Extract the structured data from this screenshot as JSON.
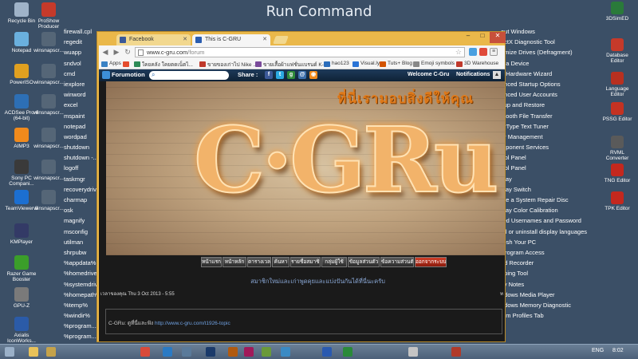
{
  "desktop": {
    "title": "Run Command",
    "left_icons": [
      {
        "label": "Recycle Bin",
        "color": "#9fb3c8"
      },
      {
        "label": "ProShow Producer",
        "color": "#c53a2a"
      },
      {
        "label": "Notepad",
        "color": "#6ab0de"
      },
      {
        "label": "winsnapscr...",
        "color": "#556677"
      },
      {
        "label": "PowerISO",
        "color": "#e0a020"
      },
      {
        "label": "winsnapscr...",
        "color": "#556677"
      },
      {
        "label": "ACDSee Pro 6 (64-bit)",
        "color": "#2d6fb5"
      },
      {
        "label": "winsnapscr...",
        "color": "#556677"
      },
      {
        "label": "AIMP3",
        "color": "#f08a1c"
      },
      {
        "label": "winsnapscr...",
        "color": "#556677"
      },
      {
        "label": "Sony PC Compani...",
        "color": "#3a3a3a"
      },
      {
        "label": "winsnapscr...",
        "color": "#556677"
      },
      {
        "label": "TeamViewer 8",
        "color": "#1c6fd1"
      },
      {
        "label": "winsnapscr...",
        "color": "#556677"
      },
      {
        "label": "KMPlayer",
        "color": "#333a66"
      },
      {
        "label": "Razer Game Booster",
        "color": "#3b9e2a"
      },
      {
        "label": "GPU-Z",
        "color": "#7a7a7a"
      },
      {
        "label": "Axialis IconWorks...",
        "color": "#2b5ba8"
      }
    ],
    "commands": [
      "firewall.cpl",
      "regedit",
      "wuapp",
      "sndvol",
      "cmd",
      "iexplore",
      "winword",
      "excel",
      "mspaint",
      "notepad",
      "wordpad",
      "shutdown",
      "shutdown -...",
      "logoff",
      "taskmgr",
      "recoverydriv...",
      "charmap",
      "osk",
      "magnify",
      "msconfig",
      "utilman",
      "shrpubw",
      "%appdata%",
      "%homedrive%",
      "%systemdrive%",
      "%homepath%",
      "%temp%",
      "%windir%",
      "%program...",
      "%program..."
    ],
    "tools": [
      "out Windows",
      "ectX Diagnostic Tool",
      "dmize Drives (Defragment)",
      "d a Device",
      "d Hardware Wizard",
      "anced Startup Options",
      "anced User Accounts",
      "kup and Restore",
      "etooth File Transfer",
      "arType Text Tuner",
      "or Management",
      "mponent Services",
      "trol Panel",
      "trol Panel",
      "play",
      "play Switch",
      "ate a System Repair Disc",
      "play Color Calibration",
      "red Usernames and Password",
      "all or uninstall display languages",
      "resh Your PC",
      "Program Access",
      "nd Recorder",
      "pping Tool",
      "ky Notes",
      "ndows Media Player",
      "ndows Memory Diagnostic",
      "tem Profiles Tab"
    ],
    "right_icons": [
      {
        "label": "3DSimED",
        "color": "#2a7a3a"
      },
      {
        "label": "Database Editor",
        "color": "#c63a2a"
      },
      {
        "label": "Language Editor",
        "color": "#b83020"
      },
      {
        "label": "PSSG Editor",
        "color": "#c43222"
      },
      {
        "label": "RVML Converter",
        "color": "#5a5a5a"
      },
      {
        "label": "TNG Editor",
        "color": "#c4281e"
      },
      {
        "label": "TPK Editor",
        "color": "#c4281e"
      }
    ]
  },
  "browser": {
    "tabs": [
      {
        "label": "Facebook",
        "active": false,
        "favicon_color": "#3b5998"
      },
      {
        "label": "This is C-GRU",
        "active": true,
        "favicon_color": "#2a5db0"
      }
    ],
    "window_controls": [
      "–",
      "□",
      "✕"
    ],
    "url_host": "www.c-gru.com",
    "url_path": "/forum",
    "bookmarks": [
      {
        "label": "Apps",
        "color": "#3b82c4"
      },
      {
        "label": "",
        "color": "#e54d2e"
      },
      {
        "label": "ใคยคลัง ใคยตดเน็ตไ...",
        "color": "#2e8b57"
      },
      {
        "label": "ขายของเก่าไป Nike ...",
        "color": "#c0392b"
      },
      {
        "label": "ขายเสื้อผ้าแฟชั่นแบรนด์ K-P...",
        "color": "#7a4a9a"
      },
      {
        "label": "hao123",
        "color": "#2b6dbb"
      },
      {
        "label": "Visual.ly",
        "color": "#2a74d6"
      },
      {
        "label": "Tuts+ Blog",
        "color": "#d35400"
      },
      {
        "label": "Emoji symbols",
        "color": "#888888"
      },
      {
        "label": "3D Warehouse",
        "color": "#c0392b"
      }
    ]
  },
  "forum": {
    "logo": "Forumotion",
    "share_label": "Share :",
    "social": [
      {
        "icon": "facebook-icon",
        "glyph": "f",
        "color": "#3b5998"
      },
      {
        "icon": "twitter-icon",
        "glyph": "t",
        "color": "#2ba9e1"
      },
      {
        "icon": "google-icon",
        "glyph": "g",
        "color": "#2f8a3a"
      },
      {
        "icon": "email-icon",
        "glyph": "@",
        "color": "#3c6eaa"
      },
      {
        "icon": "rss-icon",
        "glyph": "◉",
        "color": "#f08a1c"
      }
    ],
    "welcome": "Welcome C-Gru",
    "notifications": "Notifications",
    "banner_thai": "ที่นี่เรามอบสิ่งดีให้คุณ",
    "banner_logo": "C·GRu",
    "nav": [
      "หน้าแรก",
      "หน้าหลัก",
      "ตารางเวลา",
      "ค้นหา",
      "รายชื่อสมาชิก",
      "กลุ่มผู้ใช้",
      "ข้อมูลส่วนตัว",
      "ข้อความส่วนตัว",
      "ออกจากระบบ"
    ],
    "marquee": "สมาชิกใหม่และเก่าพูดคุยและแบ่งปันกันได้ที่นี่นะครับ",
    "last_visit": "เวลาของคุณ Thu 3 Oct 2013 - 5:55",
    "last_visit_right": "ท",
    "footer_label": "C-GRu: ดูที่นี่และฟัง",
    "footer_link": "http://www.c-gru.com/t1926-topic"
  },
  "taskbar": {
    "icons": [
      {
        "icon": "start-icon",
        "color": "#9ab0c8"
      },
      {
        "icon": "folder-icon",
        "color": "#e8c25a"
      },
      {
        "icon": "explorer-icon",
        "color": "#c4a24a"
      },
      {
        "icon": "chrome-icon",
        "color": "#d84a3a"
      },
      {
        "icon": "ie-icon",
        "color": "#2a7ac4"
      },
      {
        "icon": "app-icon",
        "color": "#5a7a9a"
      },
      {
        "icon": "photoshop-icon",
        "color": "#1a3a6a"
      },
      {
        "icon": "illustrator-icon",
        "color": "#b05a10"
      },
      {
        "icon": "indesign-icon",
        "color": "#a01a5a"
      },
      {
        "icon": "app-icon-2",
        "color": "#6a9a3a"
      },
      {
        "icon": "app-icon-3",
        "color": "#3a8ac4"
      },
      {
        "icon": "word-icon",
        "color": "#2a5ab0"
      },
      {
        "icon": "excel-icon",
        "color": "#2a8a3a"
      },
      {
        "icon": "app-icon-4",
        "color": "#c4c4c4"
      },
      {
        "icon": "app-icon-5",
        "color": "#b03a2a"
      }
    ],
    "language": "ENG",
    "time": "8:02"
  }
}
